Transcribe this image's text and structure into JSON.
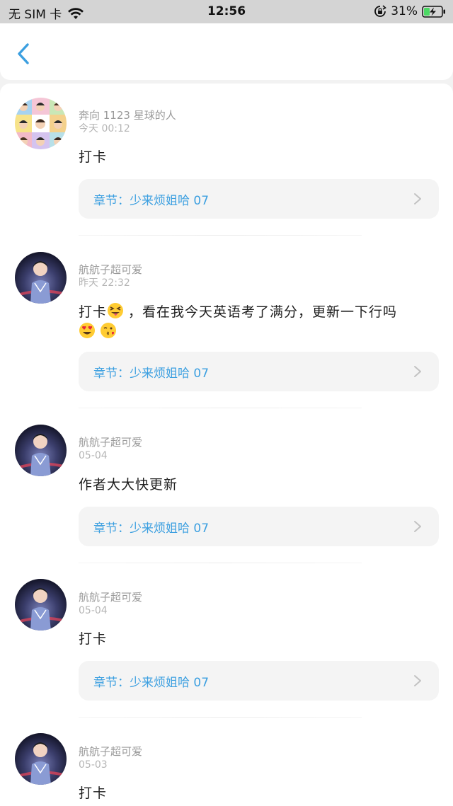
{
  "status_bar": {
    "carrier": "无 SIM 卡",
    "time": "12:56",
    "battery": "31%"
  },
  "nav": {
    "back_icon": "chevron-left-icon"
  },
  "comments": [
    {
      "username": "奔向 1123 星球的人",
      "time": "今天 00:12",
      "content": "打卡",
      "chapter": "章节：少来烦姐哈 07"
    },
    {
      "username": "航航子超可爱",
      "time": "昨天 22:32",
      "content_a": "打卡",
      "content_b": "，看在我今天英语考了满分，更新一下行吗",
      "emojis": [
        "squinting-tongue-emoji",
        "heart-eyes-emoji",
        "kissing-heart-emoji"
      ],
      "chapter": "章节：少来烦姐哈 07"
    },
    {
      "username": "航航子超可爱",
      "time": "05-04",
      "content": "作者大大快更新",
      "chapter": "章节：少来烦姐哈 07"
    },
    {
      "username": "航航子超可爱",
      "time": "05-04",
      "content": "打卡",
      "chapter": "章节：少来烦姐哈 07"
    },
    {
      "username": "航航子超可爱",
      "time": "05-03",
      "content": "打卡"
    }
  ],
  "colors": {
    "accent": "#3b9fe0",
    "status_bar_bg": "#d4d4d4",
    "battery_fill": "#4cd964"
  }
}
